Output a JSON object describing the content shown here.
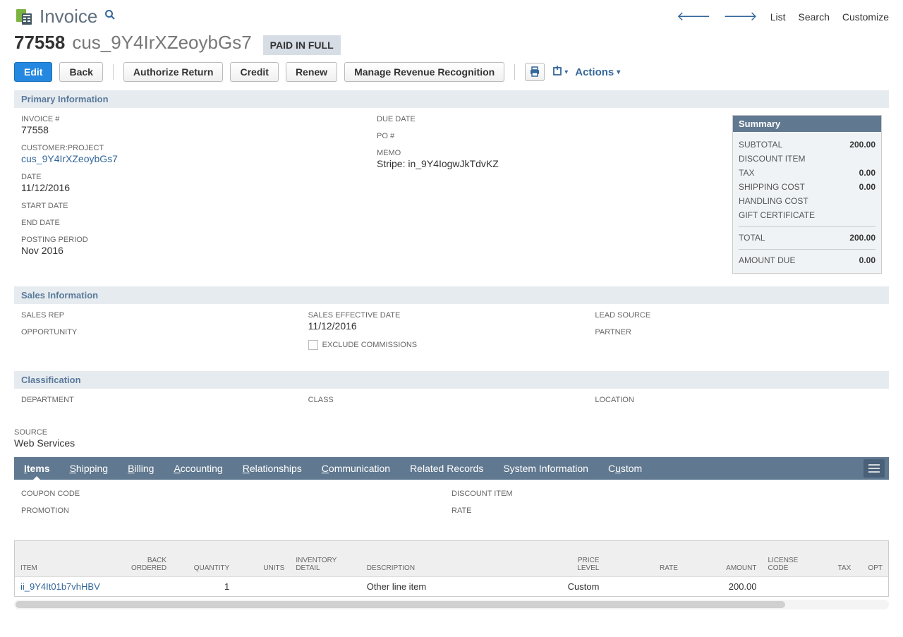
{
  "header": {
    "title": "Invoice",
    "nav": {
      "list": "List",
      "search": "Search",
      "customize": "Customize"
    }
  },
  "record": {
    "number": "77558",
    "customer": "cus_9Y4IrXZeoybGs7",
    "status_badge": "PAID IN FULL"
  },
  "buttons": {
    "edit": "Edit",
    "back": "Back",
    "authorize_return": "Authorize Return",
    "credit": "Credit",
    "renew": "Renew",
    "manage_revenue": "Manage Revenue Recognition",
    "actions": "Actions"
  },
  "sections": {
    "primary": "Primary Information",
    "sales": "Sales Information",
    "classification": "Classification"
  },
  "primary": {
    "invoice_no_label": "INVOICE #",
    "invoice_no": "77558",
    "customer_label": "CUSTOMER:PROJECT",
    "customer": "cus_9Y4IrXZeoybGs7",
    "date_label": "DATE",
    "date": "11/12/2016",
    "start_date_label": "START DATE",
    "end_date_label": "END DATE",
    "posting_period_label": "POSTING PERIOD",
    "posting_period": "Nov 2016",
    "due_date_label": "DUE DATE",
    "po_label": "PO #",
    "memo_label": "MEMO",
    "memo": "Stripe: in_9Y4IogwJkTdvKZ"
  },
  "summary": {
    "header": "Summary",
    "subtotal_label": "SUBTOTAL",
    "subtotal": "200.00",
    "discount_label": "DISCOUNT ITEM",
    "tax_label": "TAX",
    "tax": "0.00",
    "shipping_label": "SHIPPING COST",
    "shipping": "0.00",
    "handling_label": "HANDLING COST",
    "gift_label": "GIFT CERTIFICATE",
    "total_label": "TOTAL",
    "total": "200.00",
    "amount_due_label": "AMOUNT DUE",
    "amount_due": "0.00"
  },
  "sales": {
    "sales_rep_label": "SALES REP",
    "opportunity_label": "OPPORTUNITY",
    "effective_date_label": "SALES EFFECTIVE DATE",
    "effective_date": "11/12/2016",
    "exclude_commissions": "EXCLUDE COMMISSIONS",
    "lead_source_label": "LEAD SOURCE",
    "partner_label": "PARTNER"
  },
  "classification": {
    "department_label": "DEPARTMENT",
    "class_label": "CLASS",
    "location_label": "LOCATION"
  },
  "source": {
    "label": "SOURCE",
    "value": "Web Services"
  },
  "tabs": [
    "Items",
    "Shipping",
    "Billing",
    "Accounting",
    "Relationships",
    "Communication",
    "Related Records",
    "System Information",
    "Custom"
  ],
  "items_tab": {
    "coupon_label": "COUPON CODE",
    "promotion_label": "PROMOTION",
    "discount_item_label": "DISCOUNT ITEM",
    "rate_label": "RATE"
  },
  "items_table": {
    "headers": {
      "item": "ITEM",
      "back_ordered": "BACK ORDERED",
      "quantity": "QUANTITY",
      "units": "UNITS",
      "inventory_detail": "INVENTORY DETAIL",
      "description": "DESCRIPTION",
      "price_level": "PRICE LEVEL",
      "rate": "RATE",
      "amount": "AMOUNT",
      "license_code": "LICENSE CODE",
      "tax": "TAX",
      "opt": "OPT"
    },
    "row": {
      "item": "ii_9Y4It01b7vhHBV",
      "quantity": "1",
      "description": "Other line item",
      "price_level": "Custom",
      "amount": "200.00"
    }
  }
}
